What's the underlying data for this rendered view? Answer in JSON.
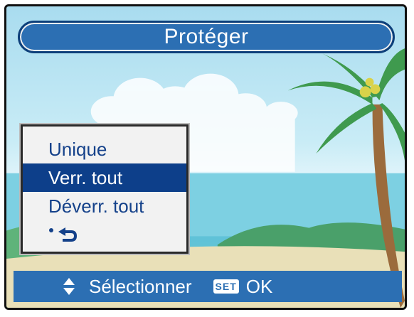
{
  "title": "Protéger",
  "menu": {
    "items": [
      {
        "label": "Unique",
        "selected": false
      },
      {
        "label": "Verr. tout",
        "selected": true
      },
      {
        "label": "Déverr. tout",
        "selected": false
      }
    ],
    "back_icon": "back-arrow-icon"
  },
  "footer": {
    "nav_icon": "up-down-arrows-icon",
    "select_label": "Sélectionner",
    "set_badge": "SET",
    "ok_label": "OK"
  },
  "colors": {
    "accent": "#2c6fb3",
    "selection": "#0d3f8a",
    "menu_text": "#14418a"
  }
}
